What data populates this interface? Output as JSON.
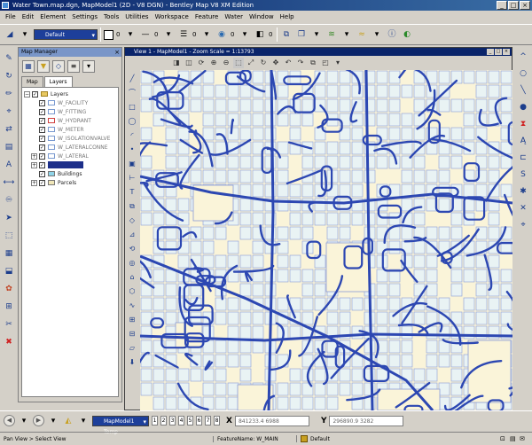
{
  "window": {
    "title": "Water Town.map.dgn, MapModel1 (2D - V8 DGN) - Bentley Map V8 XM Edition"
  },
  "menu": [
    "File",
    "Edit",
    "Element",
    "Settings",
    "Tools",
    "Utilities",
    "Workspace",
    "Feature",
    "Water",
    "Window",
    "Help"
  ],
  "toolbar": {
    "level_value": "Default",
    "color_num": "0",
    "style_num": "0",
    "weight_num": "0",
    "num4": "0",
    "num5": "0"
  },
  "map_manager": {
    "title": "Map Manager",
    "tabs": [
      "Map",
      "Layers"
    ],
    "active_tab": "Layers",
    "tree": [
      {
        "label": "Layers",
        "indent": 0,
        "expand": "−",
        "checked": true,
        "symbol": "folder"
      },
      {
        "label": "W_FACILITY",
        "indent": 1,
        "expand": "",
        "checked": true,
        "symbol": "outline",
        "color": "#7a9ad0"
      },
      {
        "label": "W_FITTING",
        "indent": 1,
        "expand": "",
        "checked": true,
        "symbol": "outline",
        "color": "#7a9ad0"
      },
      {
        "label": "W_HYDRANT",
        "indent": 1,
        "expand": "",
        "checked": true,
        "symbol": "outline",
        "color": "#d04040"
      },
      {
        "label": "W_METER",
        "indent": 1,
        "expand": "",
        "checked": true,
        "symbol": "outline",
        "color": "#7a9ad0"
      },
      {
        "label": "W_ISOLATIONVALVE",
        "indent": 1,
        "expand": "",
        "checked": true,
        "symbol": "outline",
        "color": "#7a9ad0"
      },
      {
        "label": "W_LATERALCONNE",
        "indent": 1,
        "expand": "",
        "checked": true,
        "symbol": "outline",
        "color": "#7a9ad0"
      },
      {
        "label": "W_LATERAL",
        "indent": 1,
        "expand": "+",
        "checked": true,
        "symbol": "outline",
        "color": "#7a9ad0"
      },
      {
        "label": "",
        "indent": 1,
        "expand": "+",
        "checked": true,
        "symbol": "selected",
        "color": "#1d2f8a"
      },
      {
        "label": "Buildings",
        "indent": 1,
        "expand": "",
        "checked": true,
        "symbol": "fill",
        "color": "#8fd4e8"
      },
      {
        "label": "Parcels",
        "indent": 1,
        "expand": "+",
        "checked": true,
        "symbol": "fill",
        "color": "#f0e6b8"
      }
    ]
  },
  "view": {
    "title": "View 1 - MapModel1 - Zoom Scale = 1:13793"
  },
  "bottom": {
    "model_value": "MapModel1 Temp",
    "view_numbers": [
      "1",
      "2",
      "3",
      "4",
      "5",
      "6",
      "7",
      "8"
    ],
    "x_label": "X",
    "x_value": "841233.4 6988",
    "y_label": "Y",
    "y_value": "296890.9 3282"
  },
  "status": {
    "prompt": "Pan View > Select View",
    "feature": "FeatureName: W_MAIN",
    "level": "Default"
  },
  "colors": {
    "map_bg": "#faf4d9",
    "pipe": "#2c47b2",
    "parcel_line": "#8a9bd6",
    "parcel_fill": "#e9f3f4"
  }
}
